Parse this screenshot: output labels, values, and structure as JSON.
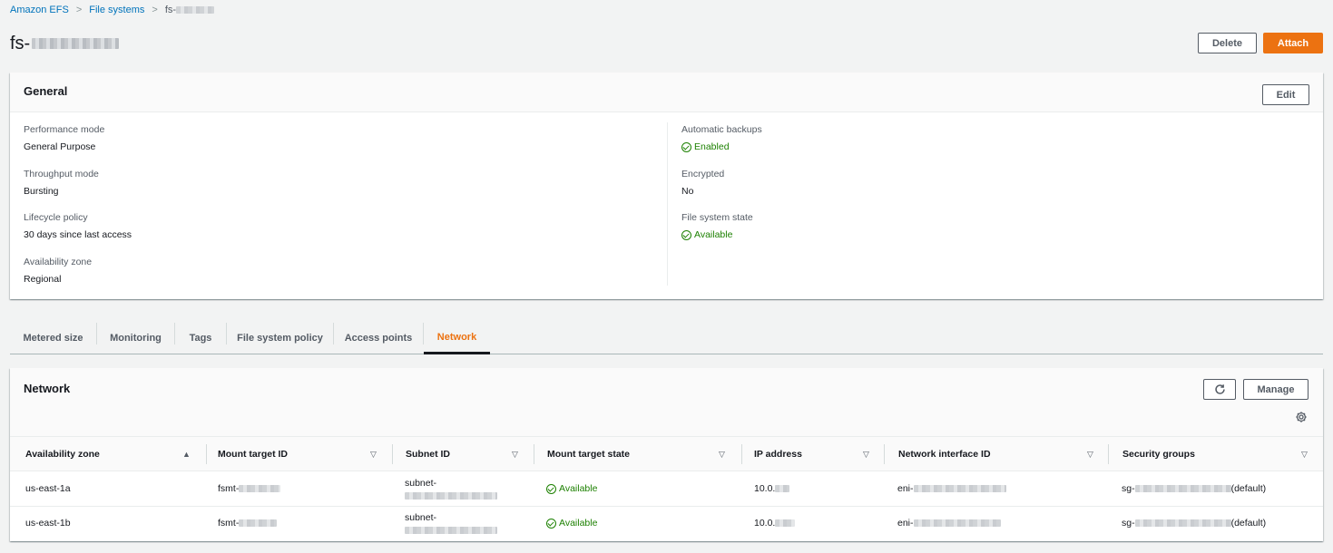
{
  "breadcrumb": {
    "items": [
      "Amazon EFS",
      "File systems"
    ],
    "current": "fs-"
  },
  "page": {
    "title": "fs-",
    "delete_label": "Delete",
    "attach_label": "Attach"
  },
  "general": {
    "title": "General",
    "edit_label": "Edit",
    "left": [
      {
        "label": "Performance mode",
        "value": "General Purpose"
      },
      {
        "label": "Throughput mode",
        "value": "Bursting"
      },
      {
        "label": "Lifecycle policy",
        "value": "30 days since last access"
      },
      {
        "label": "Availability zone",
        "value": "Regional"
      }
    ],
    "right": [
      {
        "label": "Automatic backups",
        "value": "Enabled",
        "status": "ok"
      },
      {
        "label": "Encrypted",
        "value": "No"
      },
      {
        "label": "File system state",
        "value": "Available",
        "status": "ok"
      }
    ]
  },
  "tabs": [
    "Metered size",
    "Monitoring",
    "Tags",
    "File system policy",
    "Access points",
    "Network"
  ],
  "active_tab": "Network",
  "network": {
    "title": "Network",
    "manage_label": "Manage",
    "columns": [
      "Availability zone",
      "Mount target ID",
      "Subnet ID",
      "Mount target state",
      "IP address",
      "Network interface ID",
      "Security groups"
    ],
    "rows": [
      {
        "az": "us-east-1a",
        "mount_target": "fsmt-",
        "subnet": "subnet-",
        "state": "Available",
        "ip": "10.0.",
        "eni": "eni-",
        "sg": "sg-",
        "sg_suffix": "(default)"
      },
      {
        "az": "us-east-1b",
        "mount_target": "fsmt-",
        "subnet": "subnet-",
        "state": "Available",
        "ip": "10.0.",
        "eni": "eni-",
        "sg": "sg-",
        "sg_suffix": "(default)"
      }
    ]
  },
  "colors": {
    "link": "#0073bb",
    "primary": "#ec7211",
    "success": "#1d8102",
    "background": "#f2f3f3"
  }
}
